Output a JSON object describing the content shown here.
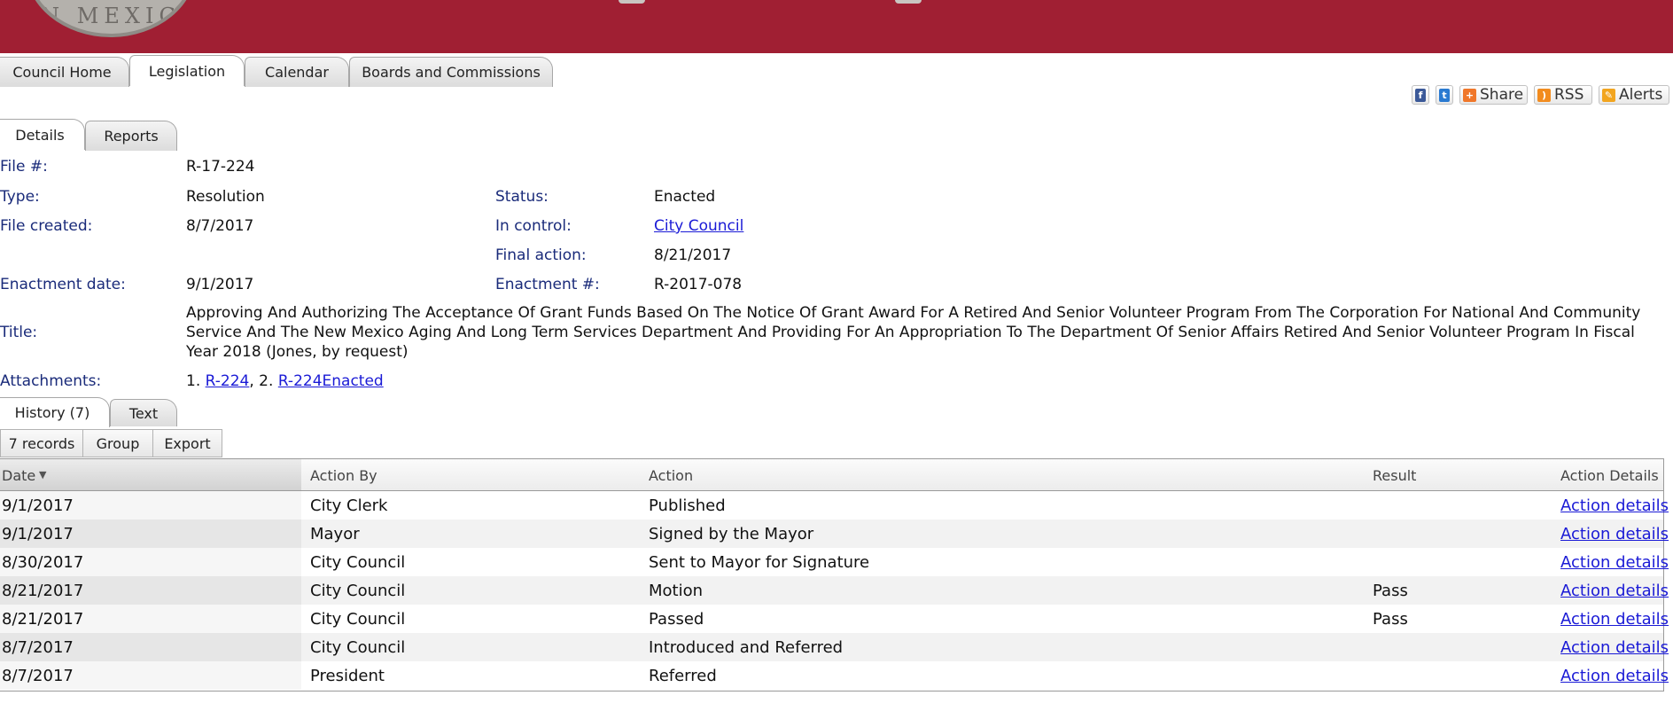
{
  "header": {
    "seal_text": "N MEXIC"
  },
  "nav": {
    "tabs": [
      {
        "label": "Council Home"
      },
      {
        "label": "Legislation"
      },
      {
        "label": "Calendar"
      },
      {
        "label": "Boards and Commissions"
      }
    ],
    "active": "Legislation"
  },
  "share": {
    "share_label": "Share",
    "rss_label": "RSS",
    "alerts_label": "Alerts"
  },
  "subtabs": [
    {
      "label": "Details"
    },
    {
      "label": "Reports"
    }
  ],
  "details": {
    "file_label": "File #:",
    "file_value": "R-17-224",
    "type_label": "Type:",
    "type_value": "Resolution",
    "status_label": "Status:",
    "status_value": "Enacted",
    "created_label": "File created:",
    "created_value": "8/7/2017",
    "control_label": "In control:",
    "control_value": "City Council",
    "final_label": "Final action:",
    "final_value": "8/21/2017",
    "enact_date_label": "Enactment date:",
    "enact_date_value": "9/1/2017",
    "enact_num_label": "Enactment #:",
    "enact_num_value": "R-2017-078",
    "title_label": "Title:",
    "title_value": "Approving And Authorizing The Acceptance Of Grant Funds Based On The Notice Of Grant Award For A Retired And Senior Volunteer Program From The Corporation For National And Community Service And The New Mexico Aging And Long Term Services Department And Providing For An Appropriation To The Department Of Senior Affairs Retired And Senior Volunteer Program In Fiscal Year 2018 (Jones, by request)",
    "attachments_label": "Attachments:",
    "attachments": [
      {
        "num": "1.",
        "name": "R-224",
        "sep": ","
      },
      {
        "num": "2.",
        "name": "R-224Enacted",
        "sep": ""
      }
    ]
  },
  "history_tabs": [
    {
      "label": "History (7)"
    },
    {
      "label": "Text"
    }
  ],
  "toolbar": {
    "records": "7 records",
    "group": "Group",
    "export": "Export"
  },
  "history": {
    "columns": [
      "Date",
      "Action By",
      "Action",
      "Result",
      "Action Details"
    ],
    "rows": [
      {
        "date": "9/1/2017",
        "by": "City Clerk",
        "action": "Published",
        "result": "",
        "details": "Action details"
      },
      {
        "date": "9/1/2017",
        "by": "Mayor",
        "action": "Signed by the Mayor",
        "result": "",
        "details": "Action details"
      },
      {
        "date": "8/30/2017",
        "by": "City Council",
        "action": "Sent to Mayor for Signature",
        "result": "",
        "details": "Action details"
      },
      {
        "date": "8/21/2017",
        "by": "City Council",
        "action": "Motion",
        "result": "Pass",
        "details": "Action details"
      },
      {
        "date": "8/21/2017",
        "by": "City Council",
        "action": "Passed",
        "result": "Pass",
        "details": "Action details"
      },
      {
        "date": "8/7/2017",
        "by": "City Council",
        "action": "Introduced and Referred",
        "result": "",
        "details": "Action details"
      },
      {
        "date": "8/7/2017",
        "by": "President",
        "action": "Referred",
        "result": "",
        "details": "Action details"
      }
    ]
  },
  "colors": {
    "banner": "#a01f33",
    "label": "#1a2b7a",
    "link": "#1a1ad6"
  }
}
